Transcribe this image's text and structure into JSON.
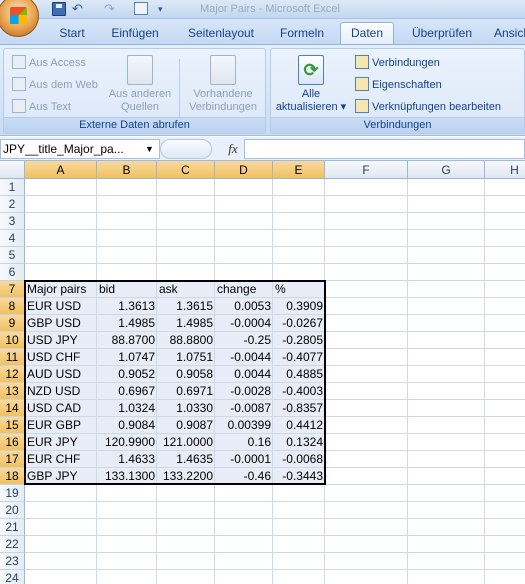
{
  "title_bar": {
    "window_title": "Major Pairs - Microsoft Excel",
    "icons": [
      "office-button",
      "save-icon",
      "undo-icon",
      "redo-icon",
      "custom-qat-icon",
      "qat-dropdown-icon"
    ]
  },
  "tabs": [
    "Start",
    "Einfügen",
    "Seitenlayout",
    "Formeln",
    "Daten",
    "Überprüfen",
    "Ansicht"
  ],
  "active_tab": "Daten",
  "ribbon": {
    "external_data": {
      "label": "Externe Daten abrufen",
      "from_access": "Aus Access",
      "from_web": "Aus dem Web",
      "from_text": "Aus Text",
      "from_other_line1": "Aus anderen",
      "from_other_line2": "Quellen",
      "existing_line1": "Vorhandene",
      "existing_line2": "Verbindungen"
    },
    "connections": {
      "label": "Verbindungen",
      "refresh_line1": "Alle",
      "refresh_line2": "aktualisieren",
      "connections": "Verbindungen",
      "properties": "Eigenschaften",
      "edit_links": "Verknüpfungen bearbeiten"
    }
  },
  "formula_bar": {
    "name_box": "JPY__title_Major_pa...",
    "fx": "fx",
    "formula": ""
  },
  "grid": {
    "columns": [
      "A",
      "B",
      "C",
      "D",
      "E",
      "F",
      "G",
      "H"
    ],
    "rows": [
      "1",
      "2",
      "3",
      "4",
      "5",
      "6",
      "7",
      "8",
      "9",
      "10",
      "11",
      "12",
      "13",
      "14",
      "15",
      "16",
      "17",
      "18",
      "19",
      "20",
      "21",
      "22",
      "23",
      "24"
    ],
    "header": [
      "Major pairs",
      "bid",
      "ask",
      "change",
      "%"
    ],
    "data": [
      [
        "EUR USD",
        "1.3613",
        "1.3615",
        "0.0053",
        "0.3909"
      ],
      [
        "GBP USD",
        "1.4985",
        "1.4985",
        "-0.0004",
        "-0.0267"
      ],
      [
        "USD JPY",
        "88.8700",
        "88.8800",
        "-0.25",
        "-0.2805"
      ],
      [
        "USD CHF",
        "1.0747",
        "1.0751",
        "-0.0044",
        "-0.4077"
      ],
      [
        "AUD USD",
        "0.9052",
        "0.9058",
        "0.0044",
        "0.4885"
      ],
      [
        "NZD USD",
        "0.6967",
        "0.6971",
        "-0.0028",
        "-0.4003"
      ],
      [
        "USD CAD",
        "1.0324",
        "1.0330",
        "-0.0087",
        "-0.8357"
      ],
      [
        "EUR GBP",
        "0.9084",
        "0.9087",
        "0.00399",
        "0.4412"
      ],
      [
        "EUR JPY",
        "120.9900",
        "121.0000",
        "0.16",
        "0.1324"
      ],
      [
        "EUR CHF",
        "1.4633",
        "1.4635",
        "-0.0001",
        "-0.0068"
      ],
      [
        "GBP JPY",
        "133.1300",
        "133.2200",
        "-0.46",
        "-0.3443"
      ]
    ]
  }
}
